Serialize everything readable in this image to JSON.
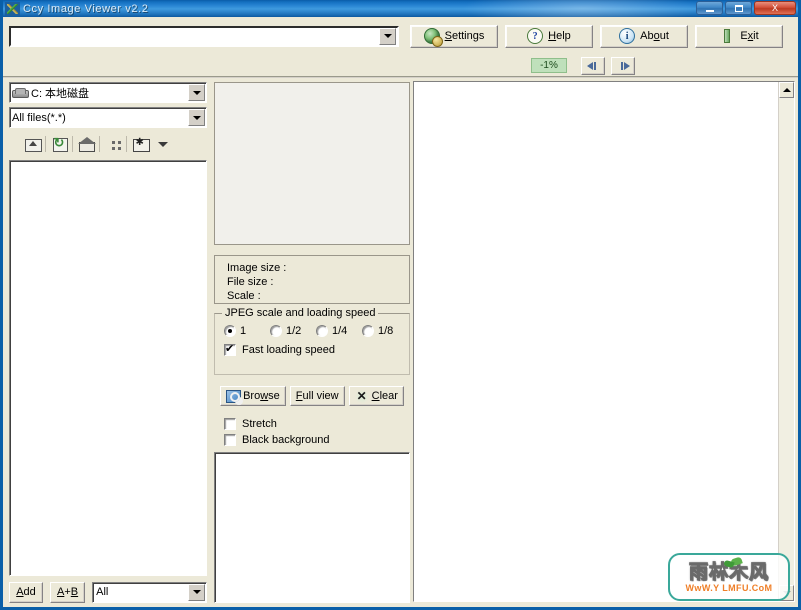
{
  "window": {
    "title": "Ccy Image Viewer v2.2",
    "icon": "app-tool-icon",
    "controls": {
      "minimize": "minimize-icon",
      "maximize": "maximize-icon",
      "close": "X"
    }
  },
  "toolbar": {
    "path_combo": {
      "value": "",
      "arrow": "chevron-down-icon"
    },
    "buttons": [
      {
        "id": "settings",
        "label_pre": "",
        "label_accel": "S",
        "label_post": "ettings",
        "icon": "globe-gear-icon"
      },
      {
        "id": "help",
        "label_pre": "",
        "label_accel": "H",
        "label_post": "elp",
        "icon": "question-mark-icon"
      },
      {
        "id": "about",
        "label_pre": "Ab",
        "label_accel": "o",
        "label_post": "ut",
        "icon": "info-icon"
      },
      {
        "id": "exit",
        "label_pre": "E",
        "label_accel": "x",
        "label_post": "it",
        "icon": "exit-bar-icon"
      }
    ]
  },
  "navstrip": {
    "zoom_value": "-1%",
    "prev_icon": "arrow-left-icon",
    "next_icon": "arrow-right-icon"
  },
  "left_panel": {
    "drive_combo": {
      "value": "C: 本地磁盘",
      "icon": "drive-icon"
    },
    "filter_combo": {
      "value": "All files(*.*)"
    },
    "icon_buttons": [
      {
        "id": "up-folder",
        "icon": "up-folder-icon"
      },
      {
        "id": "refresh",
        "icon": "refresh-icon"
      },
      {
        "id": "home",
        "icon": "home-icon"
      },
      {
        "id": "grip",
        "icon": "grip-dots-icon"
      },
      {
        "id": "favorites",
        "icon": "favorites-star-icon"
      }
    ],
    "file_list": [],
    "footer": {
      "add_pre": "",
      "add_accel": "A",
      "add_post": "dd",
      "ab_pre": "",
      "ab_accel1": "A",
      "ab_mid": "+",
      "ab_accel2": "B",
      "ab_post": "",
      "filter_value": "All"
    }
  },
  "middle_panel": {
    "thumbnail": {
      "content": ""
    },
    "info": {
      "image_size": "Image size :",
      "file_size": "File size :",
      "scale": "Scale :"
    },
    "jpeg_group": {
      "legend": "JPEG scale and loading speed",
      "options": [
        {
          "label": "1",
          "selected": true
        },
        {
          "label": "1/2",
          "selected": false
        },
        {
          "label": "1/4",
          "selected": false
        },
        {
          "label": "1/8",
          "selected": false
        }
      ],
      "fast_loading": {
        "label": "Fast loading speed",
        "checked": true
      }
    },
    "action_buttons": [
      {
        "id": "browse",
        "pre": "Bro",
        "accel": "w",
        "post": "se",
        "icon": "search-image-icon"
      },
      {
        "id": "full-view",
        "pre": "",
        "accel": "F",
        "post": "ull view",
        "icon": ""
      },
      {
        "id": "clear",
        "pre": "",
        "accel": "C",
        "post": "lear",
        "icon": "x-icon"
      }
    ],
    "checkboxes": [
      {
        "id": "stretch",
        "label": "Stretch",
        "checked": false
      },
      {
        "id": "black-background",
        "label": "Black background",
        "checked": false
      }
    ],
    "bottom_list": []
  },
  "right_panel": {
    "canvas": {
      "content": ""
    },
    "scrollbar": {
      "up": "scroll-up-icon",
      "down": "scroll-down-icon"
    }
  },
  "watermark": {
    "text_cn": "雨林木风",
    "url": "WwW.Y LMFU.CoM"
  },
  "colors": {
    "title_bar": "#1470c0",
    "face": "#ece9d8",
    "zoom_badge_bg": "#bfe0bb",
    "watermark_border": "#3aa89a",
    "watermark_url": "#ef7f28",
    "close_button": "#d2503a"
  }
}
